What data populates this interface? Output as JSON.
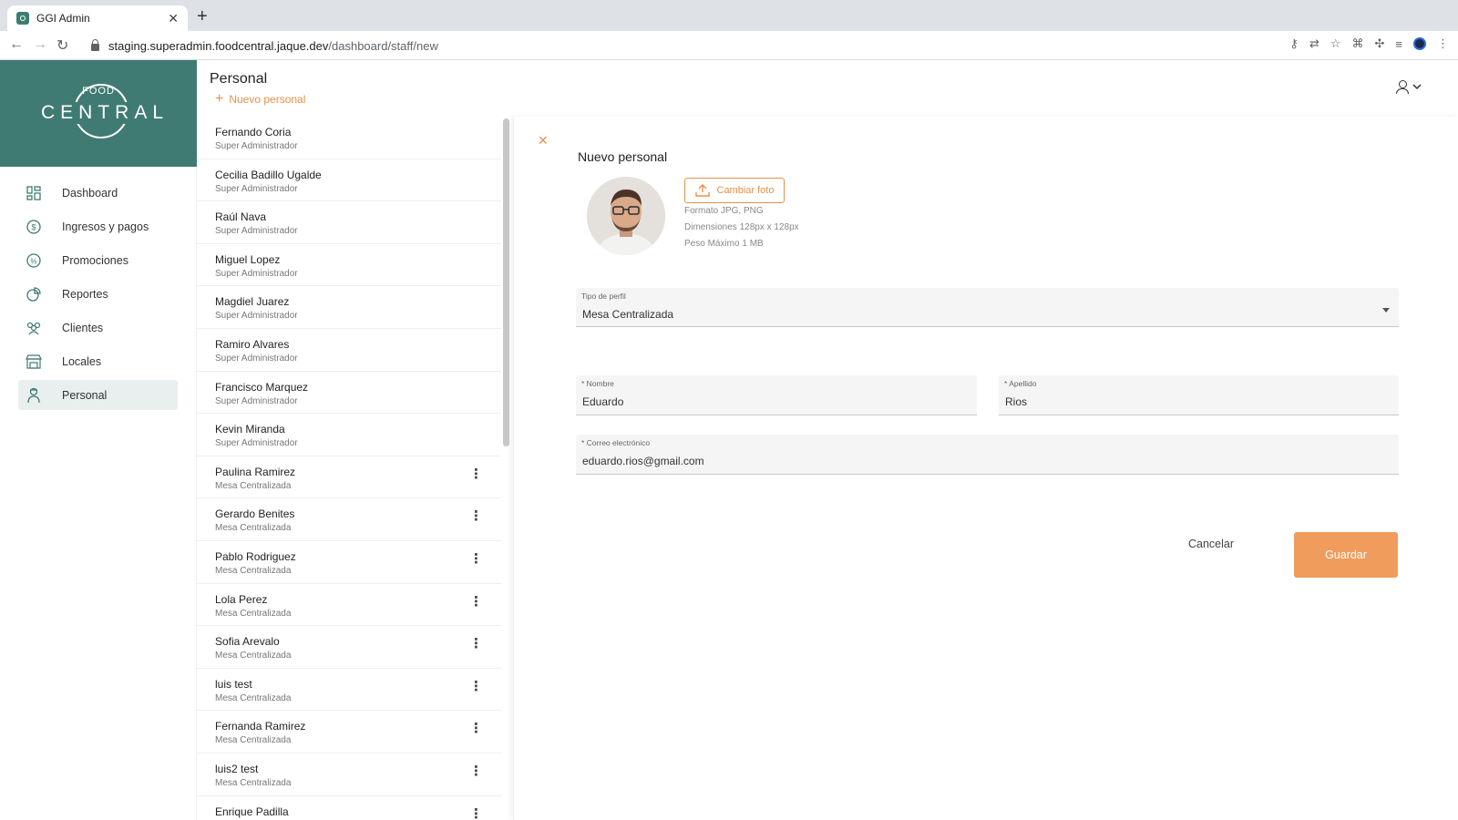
{
  "browser": {
    "tab_title": "GGI Admin",
    "url_host": "staging.superadmin.foodcentral.jaque.dev",
    "url_path": "/dashboard/staff/new"
  },
  "logo": {
    "small": "FOOD",
    "big": "CENTRAL"
  },
  "sidebar": {
    "items": [
      {
        "label": "Dashboard",
        "icon": "dashboard-icon"
      },
      {
        "label": "Ingresos y pagos",
        "icon": "dollar-icon"
      },
      {
        "label": "Promociones",
        "icon": "percent-icon"
      },
      {
        "label": "Reportes",
        "icon": "reports-icon"
      },
      {
        "label": "Clientes",
        "icon": "clients-icon"
      },
      {
        "label": "Locales",
        "icon": "store-icon"
      },
      {
        "label": "Personal",
        "icon": "staff-icon",
        "active": true
      }
    ]
  },
  "header": {
    "title": "Personal",
    "new_link": "Nuevo personal"
  },
  "staff": [
    {
      "name": "Fernando Coria",
      "role": "Super Administrador",
      "menu": false
    },
    {
      "name": "Cecilia Badillo Ugalde",
      "role": "Super Administrador",
      "menu": false
    },
    {
      "name": "Raúl Nava",
      "role": "Super Administrador",
      "menu": false
    },
    {
      "name": "Miguel Lopez",
      "role": "Super Administrador",
      "menu": false
    },
    {
      "name": "Magdiel Juarez",
      "role": "Super Administrador",
      "menu": false
    },
    {
      "name": "Ramiro Alvares",
      "role": "Super Administrador",
      "menu": false
    },
    {
      "name": "Francisco Marquez",
      "role": "Super Administrador",
      "menu": false
    },
    {
      "name": "Kevin Miranda",
      "role": "Super Administrador",
      "menu": false
    },
    {
      "name": "Paulina Ramirez",
      "role": "Mesa Centralizada",
      "menu": true
    },
    {
      "name": "Gerardo Benites",
      "role": "Mesa Centralizada",
      "menu": true
    },
    {
      "name": "Pablo Rodriguez",
      "role": "Mesa Centralizada",
      "menu": true
    },
    {
      "name": "Lola Perez",
      "role": "Mesa Centralizada",
      "menu": true
    },
    {
      "name": "Sofia Arevalo",
      "role": "Mesa Centralizada",
      "menu": true
    },
    {
      "name": "luis test",
      "role": "Mesa Centralizada",
      "menu": true
    },
    {
      "name": "Fernanda Ramirez",
      "role": "Mesa Centralizada",
      "menu": true
    },
    {
      "name": "luis2 test",
      "role": "Mesa Centralizada",
      "menu": true
    },
    {
      "name": "Enrique Padilla",
      "role": "",
      "menu": true
    }
  ],
  "form": {
    "title": "Nuevo personal",
    "change_photo": "Cambiar foto",
    "hint_format": "Formato JPG, PNG",
    "hint_dimensions": "Dimensiones 128px x 128px",
    "hint_weight": "Peso Máximo 1 MB",
    "profile_type_label": "Tipo de perfil",
    "profile_type_value": "Mesa Centralizada",
    "first_name_label": "* Nombre",
    "first_name_value": "Eduardo",
    "last_name_label": "* Apellido",
    "last_name_value": "Rios",
    "email_label": "* Correo electrónico",
    "email_value": "eduardo.rios@gmail.com",
    "cancel": "Cancelar",
    "save": "Guardar"
  },
  "colors": {
    "brand": "#3f7b72",
    "accent": "#e8904a",
    "save_button": "#ef9c5d"
  }
}
